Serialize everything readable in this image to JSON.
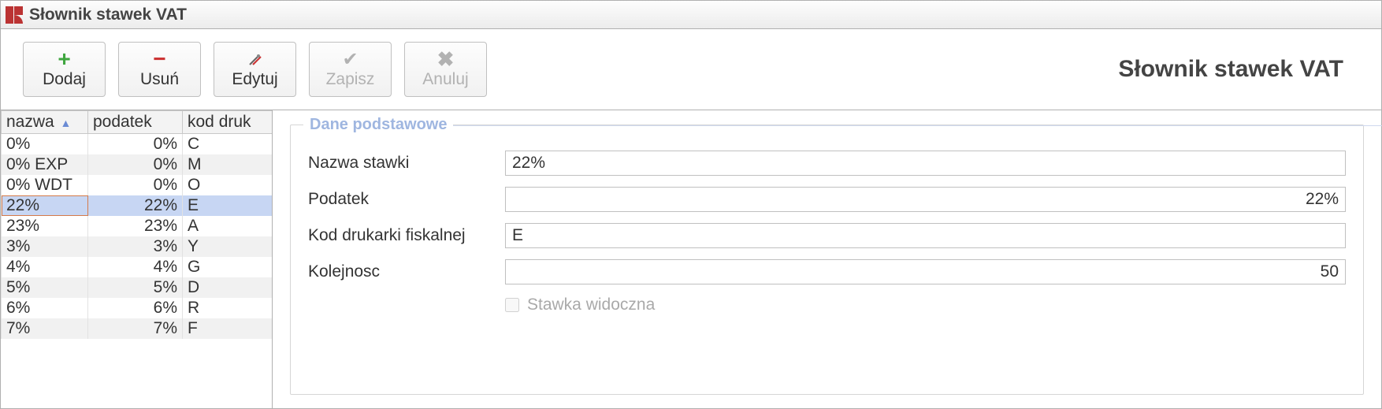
{
  "titlebar": {
    "title": "Słownik stawek VAT"
  },
  "header": {
    "title": "Słownik stawek VAT"
  },
  "toolbar": {
    "add": "Dodaj",
    "delete": "Usuń",
    "edit": "Edytuj",
    "save": "Zapisz",
    "cancel": "Anuluj"
  },
  "grid": {
    "columns": {
      "name": "nazwa",
      "tax": "podatek",
      "code": "kod druk"
    },
    "rows": [
      {
        "name": "0%",
        "tax": "0%",
        "code": "C"
      },
      {
        "name": "0% EXP",
        "tax": "0%",
        "code": "M"
      },
      {
        "name": "0% WDT",
        "tax": "0%",
        "code": "O"
      },
      {
        "name": "22%",
        "tax": "22%",
        "code": "E"
      },
      {
        "name": "23%",
        "tax": "23%",
        "code": "A"
      },
      {
        "name": "3%",
        "tax": "3%",
        "code": "Y"
      },
      {
        "name": "4%",
        "tax": "4%",
        "code": "G"
      },
      {
        "name": "5%",
        "tax": "5%",
        "code": "D"
      },
      {
        "name": "6%",
        "tax": "6%",
        "code": "R"
      },
      {
        "name": "7%",
        "tax": "7%",
        "code": "F"
      }
    ],
    "selectedIndex": 3
  },
  "detail": {
    "legend": "Dane podstawowe",
    "labels": {
      "name": "Nazwa stawki",
      "tax": "Podatek",
      "code": "Kod drukarki fiskalnej",
      "order": "Kolejnosc",
      "visible": "Stawka widoczna"
    },
    "values": {
      "name": "22%",
      "tax": "22%",
      "code": "E",
      "order": "50",
      "visible": false
    }
  }
}
